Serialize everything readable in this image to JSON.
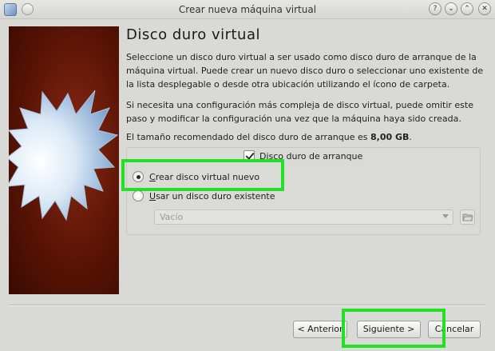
{
  "window": {
    "title": "Crear nueva máquina virtual",
    "help_glyph": "?",
    "min_glyph": "⌄",
    "max_glyph": "⌃",
    "close_glyph": "✕"
  },
  "page": {
    "heading": "Disco duro virtual",
    "paragraph1": "Seleccione un disco duro virtual a ser usado como disco duro de arranque de la máquina virtual. Puede crear un nuevo disco duro o seleccionar uno existente de la lista desplegable o desde otra ubicación utilizando el ícono de carpeta.",
    "paragraph2": "Si necesita una configuración más compleja de disco virtual, puede omitir este paso y modificar la configuración una vez que la máquina haya sido creada.",
    "recommended_prefix": "El tamaño recomendado del disco duro de arranque es ",
    "recommended_size": "8,00 GB",
    "recommended_suffix": "."
  },
  "group": {
    "checkbox_label": "Disco duro de arranque",
    "checkbox_checked": true,
    "options": [
      {
        "mnemonic": "C",
        "rest": "rear disco virtual nuevo",
        "selected": true
      },
      {
        "mnemonic": "U",
        "rest": "sar un disco duro existente",
        "selected": false
      }
    ],
    "existing_disk_value": "Vacío"
  },
  "buttons": {
    "back": "< Anterior",
    "next": "Siguiente >",
    "cancel": "Cancelar"
  },
  "colors": {
    "highlight": "#22e022",
    "banner": "#5a1405"
  },
  "icons": {
    "app": "virtualbox-icon",
    "folder": "folder-open-icon",
    "dropdown": "chevron-down-icon"
  }
}
